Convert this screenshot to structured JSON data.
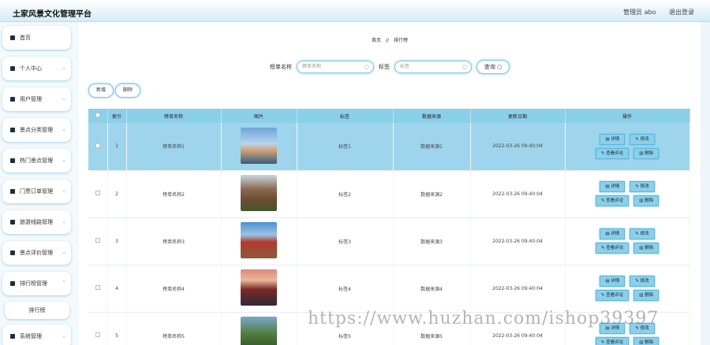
{
  "header": {
    "title": "土家风景文化管理平台",
    "admin_label": "管理员 abo",
    "logout": "退出登录"
  },
  "sidebar": {
    "items": [
      {
        "label": "首页",
        "icon": "home-icon"
      },
      {
        "label": "个人中心",
        "icon": "user-icon"
      },
      {
        "label": "用户管理",
        "icon": "users-icon"
      },
      {
        "label": "景点分类管理",
        "icon": "user-icon"
      },
      {
        "label": "热门景点管理",
        "icon": "grid-icon"
      },
      {
        "label": "门票订单管理",
        "icon": "ticket-icon"
      },
      {
        "label": "旅游线路管理",
        "icon": "grid-icon"
      },
      {
        "label": "景点评价管理",
        "icon": "comment-icon"
      },
      {
        "label": "排行榜管理",
        "icon": "grid-icon"
      },
      {
        "label": "系统管理",
        "icon": "chart-icon"
      }
    ],
    "sub_item": "排行榜"
  },
  "breadcrumb": {
    "home": "首页",
    "sep": "//",
    "current": "排行榜"
  },
  "search": {
    "name_label": "榜单名称",
    "name_placeholder": "榜单名称",
    "tag_label": "标签",
    "tag_placeholder": "标签",
    "query_button": "查询"
  },
  "actions": {
    "add": "新增",
    "delete": "删除"
  },
  "table": {
    "headers": [
      "索引",
      "榜单名称",
      "图片",
      "标签",
      "数据来源",
      "更新日期",
      "操作"
    ],
    "op_labels": {
      "detail": "详情",
      "edit": "修改",
      "comments": "查看评论",
      "delete": "删除"
    },
    "rows": [
      {
        "index": "1",
        "name": "榜单名称1",
        "tag": "标签1",
        "source": "数据来源1",
        "date": "2022-03-26 09:40:04"
      },
      {
        "index": "2",
        "name": "榜单名称2",
        "tag": "标签2",
        "source": "数据来源2",
        "date": "2022-03-26 09:40:04"
      },
      {
        "index": "3",
        "name": "榜单名称3",
        "tag": "标签3",
        "source": "数据来源3",
        "date": "2022-03-26 09:40:04"
      },
      {
        "index": "4",
        "name": "榜单名称4",
        "tag": "标签4",
        "source": "数据来源4",
        "date": "2022-03-26 09:40:04"
      },
      {
        "index": "5",
        "name": "榜单名称5",
        "tag": "标签5",
        "source": "数据来源5",
        "date": "2022-03-26 09:40:04"
      }
    ]
  },
  "watermark": "https://www.huzhan.com/ishop39397"
}
